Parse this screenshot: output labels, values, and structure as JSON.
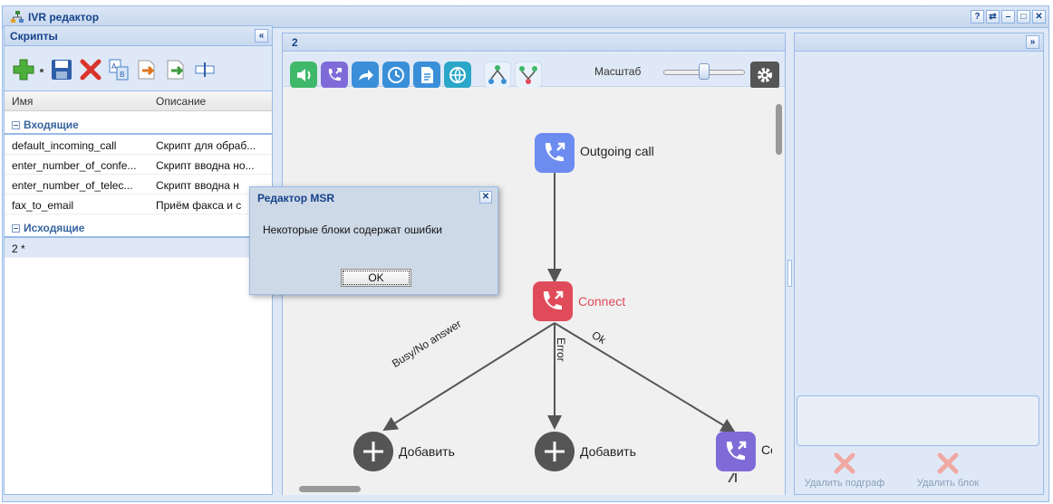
{
  "window": {
    "title": "IVR редактор",
    "tools": [
      "?",
      "⇄",
      "–",
      "□",
      "✕"
    ]
  },
  "scripts_panel": {
    "title": "Скрипты",
    "collapse": "«",
    "columns": [
      "Имя",
      "Описание"
    ],
    "groups": [
      {
        "name": "Входящие",
        "rows": [
          {
            "name": "default_incoming_call",
            "desc": "Скрипт для обраб..."
          },
          {
            "name": "enter_number_of_confe...",
            "desc": "Скрипт вводна но..."
          },
          {
            "name": "enter_number_of_telec...",
            "desc": "Скрипт вводна н"
          },
          {
            "name": "fax_to_email",
            "desc": "Приём факса и с"
          }
        ]
      },
      {
        "name": "Исходящие",
        "rows": [
          {
            "name": "2 *",
            "desc": ""
          }
        ]
      }
    ]
  },
  "editor_panel": {
    "tab_title": "2",
    "scale_label": "Масштаб",
    "scale_value": 0.5
  },
  "canvas": {
    "nodes": [
      {
        "label": "Outgoing call",
        "icon": "outgoing-call-icon",
        "color": "#6c8cf0"
      },
      {
        "label": "Connect",
        "icon": "connect-icon",
        "color": "#e04b5a"
      },
      {
        "label": "Co",
        "icon": "connect-icon",
        "color": "#7f6bd8"
      }
    ],
    "add_nodes": [
      {
        "label": "Добавить"
      },
      {
        "label": "Добавить"
      }
    ],
    "edges": [
      "Busy/No answer",
      "Error",
      "Ok"
    ]
  },
  "right_panel": {
    "expand": "»",
    "buttons": [
      {
        "label": "Удалить подграф"
      },
      {
        "label": "Удалить блок"
      }
    ]
  },
  "dialog": {
    "title": "Редактор MSR",
    "message": "Некоторые блоки содержат ошибки",
    "ok": "OK",
    "close": "✕"
  },
  "colors": {
    "accent": "#15428b",
    "error": "#e04b5a",
    "node_blue": "#6c8cf0",
    "node_purple": "#7f6bd8"
  }
}
